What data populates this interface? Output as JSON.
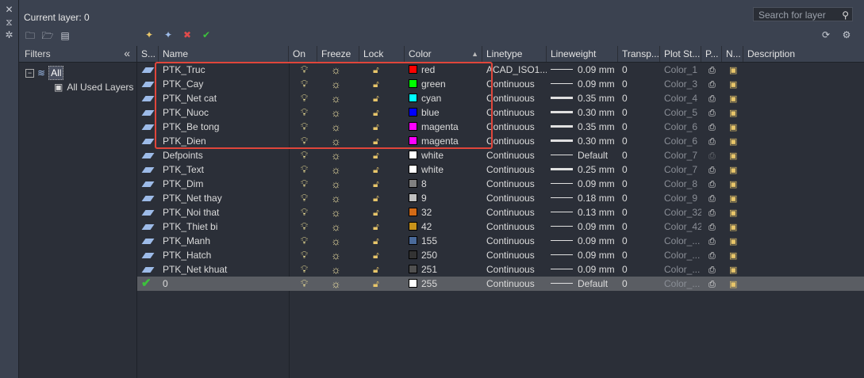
{
  "header": {
    "current_layer": "Current layer: 0",
    "search_placeholder": "Search for layer"
  },
  "filters": {
    "title": "Filters",
    "tree": [
      {
        "label": "All"
      },
      {
        "label": "All Used Layers"
      }
    ]
  },
  "columns": {
    "status": "S...",
    "name": "Name",
    "on": "On",
    "freeze": "Freeze",
    "lock": "Lock",
    "color": "Color",
    "linetype": "Linetype",
    "lineweight": "Lineweight",
    "transparency": "Transp...",
    "plot_style": "Plot St...",
    "plot": "P...",
    "newvp": "N...",
    "description": "Description"
  },
  "layers": [
    {
      "name": "PTK_Truc",
      "color_name": "red",
      "color_hex": "#ff0000",
      "linetype": "ACAD_ISO1...",
      "lineweight": "0.09 mm",
      "lw_heavy": false,
      "transparency": "0",
      "plot_style": "Color_1"
    },
    {
      "name": "PTK_Cay",
      "color_name": "green",
      "color_hex": "#00ff00",
      "linetype": "Continuous",
      "lineweight": "0.09 mm",
      "lw_heavy": false,
      "transparency": "0",
      "plot_style": "Color_3"
    },
    {
      "name": "PTK_Net cat",
      "color_name": "cyan",
      "color_hex": "#00ffff",
      "linetype": "Continuous",
      "lineweight": "0.35 mm",
      "lw_heavy": true,
      "transparency": "0",
      "plot_style": "Color_4"
    },
    {
      "name": "PTK_Nuoc",
      "color_name": "blue",
      "color_hex": "#0000ff",
      "linetype": "Continuous",
      "lineweight": "0.30 mm",
      "lw_heavy": true,
      "transparency": "0",
      "plot_style": "Color_5"
    },
    {
      "name": "PTK_Be tong",
      "color_name": "magenta",
      "color_hex": "#ff00ff",
      "linetype": "Continuous",
      "lineweight": "0.35 mm",
      "lw_heavy": true,
      "transparency": "0",
      "plot_style": "Color_6"
    },
    {
      "name": "PTK_Dien",
      "color_name": "magenta",
      "color_hex": "#ff00ff",
      "linetype": "Continuous",
      "lineweight": "0.30 mm",
      "lw_heavy": true,
      "transparency": "0",
      "plot_style": "Color_6"
    },
    {
      "name": "Defpoints",
      "color_name": "white",
      "color_hex": "#ffffff",
      "linetype": "Continuous",
      "lineweight": "Default",
      "lw_heavy": false,
      "transparency": "0",
      "plot_style": "Color_7"
    },
    {
      "name": "PTK_Text",
      "color_name": "white",
      "color_hex": "#ffffff",
      "linetype": "Continuous",
      "lineweight": "0.25 mm",
      "lw_heavy": true,
      "transparency": "0",
      "plot_style": "Color_7"
    },
    {
      "name": "PTK_Dim",
      "color_name": "8",
      "color_hex": "#808080",
      "linetype": "Continuous",
      "lineweight": "0.09 mm",
      "lw_heavy": false,
      "transparency": "0",
      "plot_style": "Color_8"
    },
    {
      "name": "PTK_Net thay",
      "color_name": "9",
      "color_hex": "#c0c0c0",
      "linetype": "Continuous",
      "lineweight": "0.18 mm",
      "lw_heavy": false,
      "transparency": "0",
      "plot_style": "Color_9"
    },
    {
      "name": "PTK_Noi that",
      "color_name": "32",
      "color_hex": "#d26a16",
      "linetype": "Continuous",
      "lineweight": "0.13 mm",
      "lw_heavy": false,
      "transparency": "0",
      "plot_style": "Color_32"
    },
    {
      "name": "PTK_Thiet bi",
      "color_name": "42",
      "color_hex": "#c8931a",
      "linetype": "Continuous",
      "lineweight": "0.09 mm",
      "lw_heavy": false,
      "transparency": "0",
      "plot_style": "Color_42"
    },
    {
      "name": "PTK_Manh",
      "color_name": "155",
      "color_hex": "#4a6a9a",
      "linetype": "Continuous",
      "lineweight": "0.09 mm",
      "lw_heavy": false,
      "transparency": "0",
      "plot_style": "Color_..."
    },
    {
      "name": "PTK_Hatch",
      "color_name": "250",
      "color_hex": "#333333",
      "linetype": "Continuous",
      "lineweight": "0.09 mm",
      "lw_heavy": false,
      "transparency": "0",
      "plot_style": "Color_..."
    },
    {
      "name": "PTK_Net khuat",
      "color_name": "251",
      "color_hex": "#505050",
      "linetype": "Continuous",
      "lineweight": "0.09 mm",
      "lw_heavy": false,
      "transparency": "0",
      "plot_style": "Color_..."
    },
    {
      "name": "0",
      "color_name": "255",
      "color_hex": "#ffffff",
      "linetype": "Continuous",
      "lineweight": "Default",
      "lw_heavy": false,
      "transparency": "0",
      "plot_style": "Color_...",
      "current": true
    }
  ],
  "icons": {
    "close": "close-icon",
    "pin": "pin-icon",
    "settings": "gear-icon",
    "refresh": "refresh-icon",
    "search": "search-icon"
  },
  "highlight_color": "#e0463b"
}
